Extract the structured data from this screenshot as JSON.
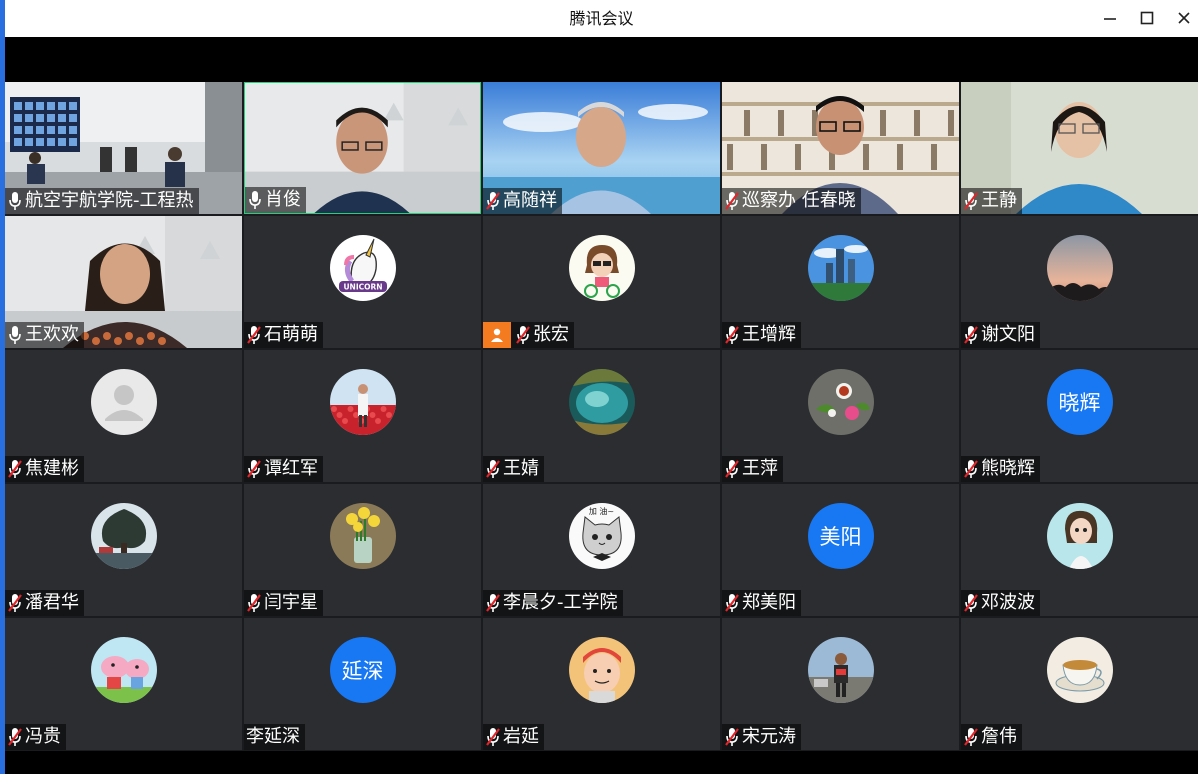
{
  "window": {
    "title": "腾讯会议",
    "minimize_icon": "minimize-icon",
    "maximize_icon": "maximize-icon",
    "close_icon": "close-icon"
  },
  "participants": [
    {
      "name": "航空宇航学院-工程热",
      "mic": "on",
      "video": "room"
    },
    {
      "name": "肖俊",
      "mic": "on",
      "video": "man-office",
      "active": true
    },
    {
      "name": "高随祥",
      "mic": "muted",
      "video": "man-beach"
    },
    {
      "name": "巡察办 任春晓",
      "mic": "muted",
      "video": "man-shelves"
    },
    {
      "name": "王静",
      "mic": "muted",
      "video": "woman-blue"
    },
    {
      "name": "王欢欢",
      "mic": "on",
      "video": "woman-office"
    },
    {
      "name": "石萌萌",
      "mic": "muted",
      "avatar": "unicorn"
    },
    {
      "name": "张宏",
      "mic": "muted",
      "avatar": "cartoon-bike",
      "host": true
    },
    {
      "name": "王增辉",
      "mic": "muted",
      "avatar": "city"
    },
    {
      "name": "谢文阳",
      "mic": "muted",
      "avatar": "sunset"
    },
    {
      "name": "焦建彬",
      "mic": "muted",
      "avatar": "default"
    },
    {
      "name": "谭红军",
      "mic": "muted",
      "avatar": "flowers-field"
    },
    {
      "name": "王婧",
      "mic": "muted",
      "avatar": "lake"
    },
    {
      "name": "王萍",
      "mic": "muted",
      "avatar": "rose"
    },
    {
      "name": "熊晓辉",
      "mic": "muted",
      "avatar_text": "晓辉"
    },
    {
      "name": "潘君华",
      "mic": "muted",
      "avatar": "tree"
    },
    {
      "name": "闫宇星",
      "mic": "muted",
      "avatar": "daffodils"
    },
    {
      "name": "李晨夕-工学院",
      "mic": "muted",
      "avatar": "cat",
      "avatar_caption": "加 油~"
    },
    {
      "name": "郑美阳",
      "mic": "muted",
      "avatar_text": "美阳"
    },
    {
      "name": "邓波波",
      "mic": "muted",
      "avatar": "cartoon-girl"
    },
    {
      "name": "冯贵",
      "mic": "muted",
      "avatar": "peppa"
    },
    {
      "name": "李延深",
      "mic": "none",
      "avatar_text": "延深"
    },
    {
      "name": "岩延",
      "mic": "muted",
      "avatar": "cartoon-face"
    },
    {
      "name": "宋元涛",
      "mic": "muted",
      "avatar": "runner"
    },
    {
      "name": "詹伟",
      "mic": "muted",
      "avatar": "teacup"
    }
  ]
}
